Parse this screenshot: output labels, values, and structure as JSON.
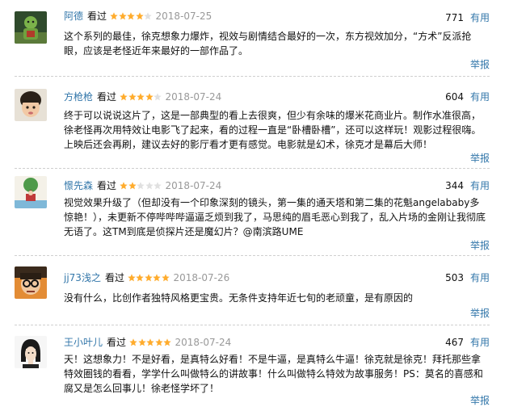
{
  "reviews": [
    {
      "user": "阿德",
      "watched": "看过",
      "rating": 4,
      "date": "2018-07-25",
      "votes": "771",
      "useful": "有用",
      "content": "这个系列的最佳，徐克想象力爆炸，视效与剧情结合最好的一次，东方视效加分，“方术”反派抢眼，应该是老怪近年来最好的一部作品了。",
      "report": "举报",
      "avatar": "avatar-green-figure"
    },
    {
      "user": "方枪枪",
      "watched": "看过",
      "rating": 4,
      "date": "2018-07-24",
      "votes": "604",
      "useful": "有用",
      "content": "终于可以说说这片了，这是一部典型的看上去很爽，但少有余味的爆米花商业片。制作水准很高，徐老怪再次用特效让电影飞了起来，看的过程一直是“卧槽卧槽”，还可以这样玩！观影过程很嗨。上映后还会再刷，建议去好的影厅看才更有感觉。电影就是幻术，徐克才是幕后大师！",
      "report": "举报",
      "avatar": "avatar-child"
    },
    {
      "user": "憬先森",
      "watched": "看过",
      "rating": 2,
      "date": "2018-07-24",
      "votes": "344",
      "useful": "有用",
      "content": "视觉效果升级了（但却没有一个印象深刻的镜头，第一集的通天塔和第二集的花魁angelababy多惊艳！），未更新不停哔哔哔逼逼乏烦到我了，马思纯的眉毛恶心到我了，乱入片场的金刚让我彻底无语了。这TM到底是侦探片还是魔幻片？@南滨路UME",
      "report": "举报",
      "avatar": "avatar-tree-figure"
    },
    {
      "user": "jj73浅之",
      "watched": "看过",
      "rating": 5,
      "date": "2018-07-26",
      "votes": "503",
      "useful": "有用",
      "content": "没有什么，比创作者独特风格更宝贵。无条件支持年近七旬的老顽童，是有原因的",
      "report": "举报",
      "avatar": "avatar-glasses-face"
    },
    {
      "user": "王小叶儿",
      "watched": "看过",
      "rating": 5,
      "date": "2018-07-24",
      "votes": "467",
      "useful": "有用",
      "content": "天！这想象力！不是好看，是真特么好看！不是牛逼，是真特么牛逼！徐克就是徐克！拜托那些拿特效圈钱的看看，学学什么叫做特么的讲故事！什么叫做特么特效为故事服务！PS：莫名的喜感和腐又是怎么回事儿！徐老怪学坏了！",
      "report": "举报",
      "avatar": "avatar-bob-hair"
    }
  ],
  "colors": {
    "link": "#3377aa",
    "star_on": "#ffac2d",
    "star_off": "#e0e0e0",
    "date": "#999999"
  }
}
